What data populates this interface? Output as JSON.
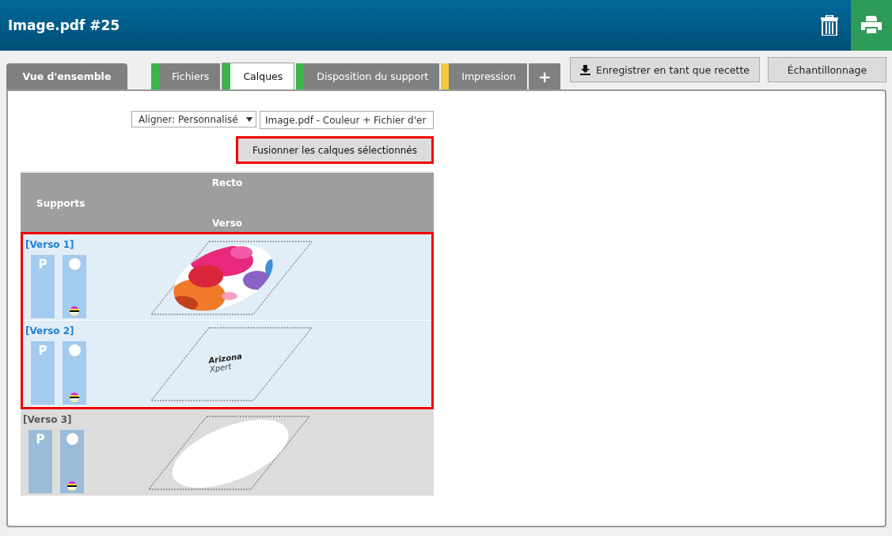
{
  "window": {
    "title": "Image.pdf #25"
  },
  "tabs": [
    {
      "label": "Vue d'ensemble",
      "kind": "overview",
      "selected": false
    },
    {
      "label": "Fichiers",
      "kind": "step",
      "selected": false,
      "color": "#3cb44b"
    },
    {
      "label": "Calques",
      "kind": "step",
      "selected": true,
      "color": "#3cb44b"
    },
    {
      "label": "Disposition du support",
      "kind": "step",
      "selected": false,
      "color": "#3cb44b"
    },
    {
      "label": "Impression",
      "kind": "step",
      "selected": false,
      "color": "#f5c842"
    },
    {
      "label": "+",
      "kind": "add",
      "selected": false
    }
  ],
  "toolbar": [
    {
      "label": "Enregistrer en tant que recette",
      "kind": "download"
    },
    {
      "label": "Échantillonnage",
      "kind": "plain"
    }
  ],
  "align_dropdown": {
    "value": "Aligner: Personnalisé"
  },
  "file_field": {
    "value": "Image.pdf - Couleur + Fichier d'er"
  },
  "merge_button": {
    "label": "Fusionner les calques sélectionnés"
  },
  "table": {
    "header_top": "Recto",
    "header_left": "Supports",
    "header_bottom": "Verso"
  },
  "layers": [
    {
      "label": "[Verso 1]",
      "selected": true,
      "media": "P"
    },
    {
      "label": "[Verso 2]",
      "selected": true,
      "media": "P",
      "thumbnail": {
        "kind": "logo",
        "lines": [
          "Arizona",
          "Xpert"
        ]
      }
    },
    {
      "label": "[Verso 3]",
      "selected": false,
      "media": "P",
      "thumbnail": {
        "kind": "shape"
      }
    }
  ]
}
